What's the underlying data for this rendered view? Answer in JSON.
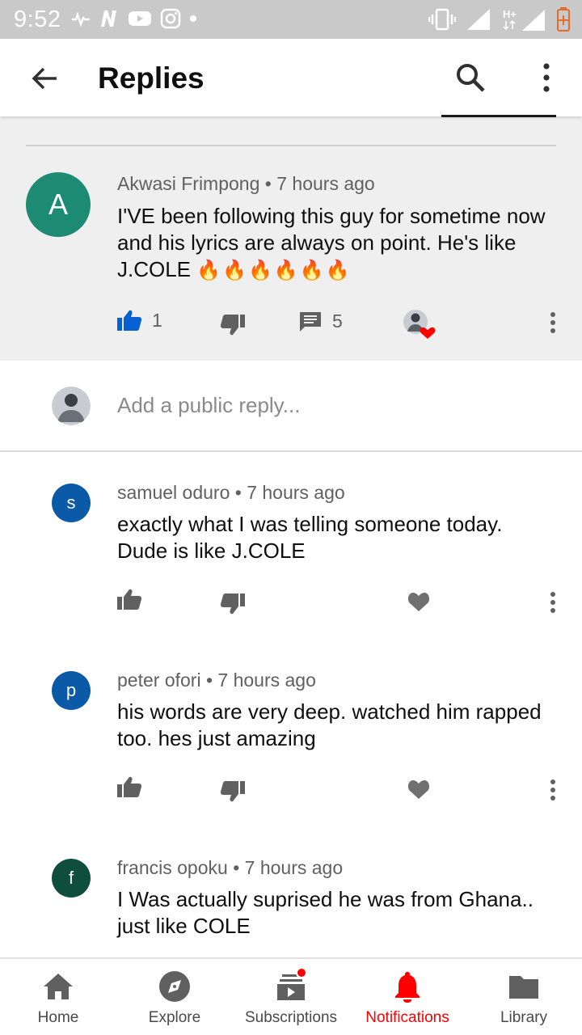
{
  "status_bar": {
    "time": "9:52"
  },
  "app_bar": {
    "title": "Replies"
  },
  "parent_comment": {
    "avatar_letter": "A",
    "author": "Akwasi Frimpong",
    "time": "7 hours ago",
    "text": "I'VE been following this guy for sometime now and his lyrics are always on point. He's like J.COLE",
    "emoji": "🔥🔥🔥🔥🔥🔥",
    "likes": "1",
    "replies_count": "5"
  },
  "reply_input": {
    "placeholder": "Add a public reply..."
  },
  "replies": [
    {
      "avatar_letter": "s",
      "avatar_color": "#0b5aa7",
      "author": "samuel oduro",
      "time": "7 hours ago",
      "text": "exactly what I was telling someone today. Dude is like J.COLE"
    },
    {
      "avatar_letter": "p",
      "avatar_color": "#0b5aa7",
      "author": "peter ofori",
      "time": "7 hours ago",
      "text": "his words are very deep. watched him rapped too. hes just amazing"
    },
    {
      "avatar_letter": "f",
      "avatar_color": "#0e4e3a",
      "author": "francis opoku",
      "time": "7 hours ago",
      "text": "I Was actually suprised he was from Ghana.. just like COLE"
    }
  ],
  "bottom_nav": [
    {
      "label": "Home",
      "icon": "home-icon"
    },
    {
      "label": "Explore",
      "icon": "explore-icon"
    },
    {
      "label": "Subscriptions",
      "icon": "subscriptions-icon"
    },
    {
      "label": "Notifications",
      "icon": "notifications-icon"
    },
    {
      "label": "Library",
      "icon": "library-icon"
    }
  ],
  "colors": {
    "accent": "#ff0000",
    "like_active": "#065fd4",
    "heart": "#ff0000"
  }
}
